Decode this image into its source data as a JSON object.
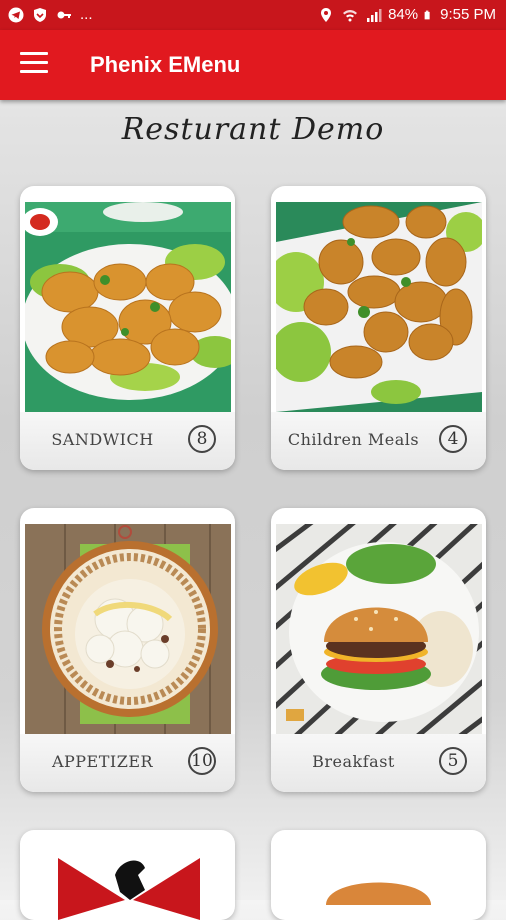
{
  "status_bar": {
    "left_icons": [
      "telegram-icon",
      "shield-icon",
      "key-icon"
    ],
    "more": "...",
    "battery": "84%",
    "time": "9:55 PM"
  },
  "app_bar": {
    "title": "Phenix EMenu"
  },
  "restaurant": {
    "name": "Resturant Demo"
  },
  "categories": [
    {
      "name": "SANDWICH",
      "count": "8"
    },
    {
      "name": "Children Meals",
      "count": "4"
    },
    {
      "name": "APPETIZER",
      "count": "10"
    },
    {
      "name": "Breakfast",
      "count": "5"
    }
  ],
  "colors": {
    "primary": "#e1191f",
    "status": "#c8161c"
  }
}
